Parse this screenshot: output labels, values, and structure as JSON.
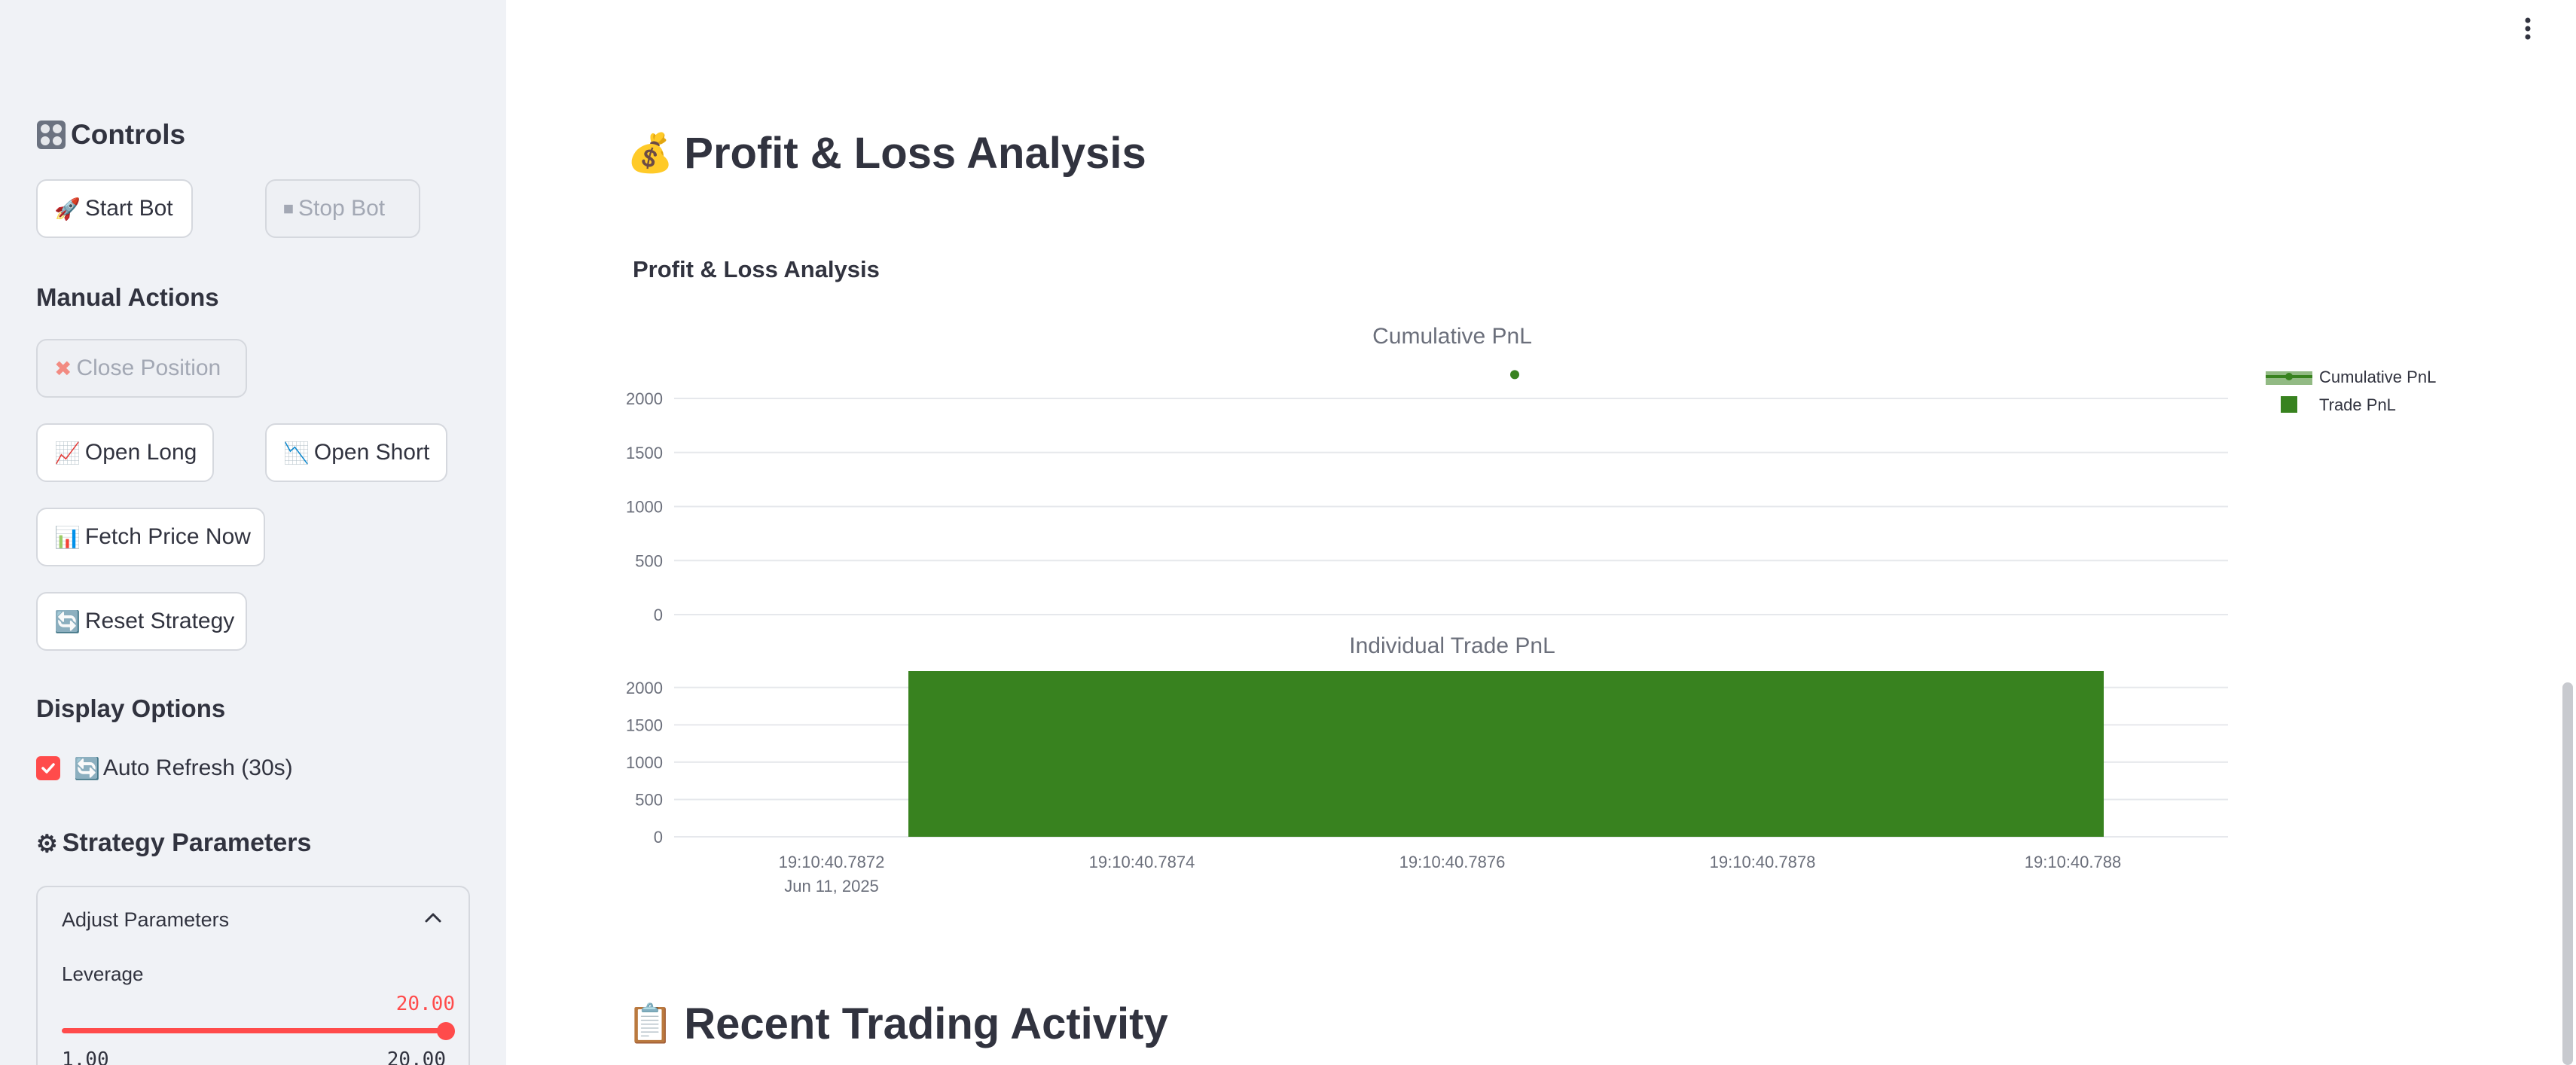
{
  "sidebar": {
    "controls_heading": "Controls",
    "start_bot": "Start Bot",
    "stop_bot": "Stop Bot",
    "manual_actions": "Manual Actions",
    "close_position": "Close Position",
    "open_long": "Open Long",
    "open_short": "Open Short",
    "fetch_price": "Fetch Price Now",
    "reset_strategy": "Reset Strategy",
    "display_options": "Display Options",
    "auto_refresh": "Auto Refresh (30s)",
    "auto_refresh_checked": true,
    "strategy_parameters": "Strategy Parameters",
    "expander_title": "Adjust Parameters",
    "leverage_label": "Leverage",
    "leverage_value": "20.00",
    "leverage_min": "1.00",
    "leverage_max": "20.00",
    "leverage_fraction": 1.0
  },
  "main": {
    "pnl_heading": "Profit & Loss Analysis",
    "chart_heading": "Profit & Loss Analysis",
    "recent_heading": "Recent Trading Activity"
  },
  "colors": {
    "accent": "#ff4b4b",
    "series_green": "#38821f",
    "text": "#31333f",
    "sidebar_bg": "#f0f2f6"
  },
  "chart_data": {
    "type": "bar",
    "subplots": [
      {
        "title": "Cumulative PnL",
        "type": "line",
        "yticks": [
          0,
          500,
          1000,
          1500,
          2000
        ],
        "ylim": [
          0,
          2000
        ],
        "series": [
          {
            "name": "Cumulative PnL",
            "x": [
              "19:10:40.7876"
            ],
            "y": [
              2220
            ]
          }
        ]
      },
      {
        "title": "Individual Trade PnL",
        "type": "bar",
        "yticks": [
          0,
          500,
          1000,
          1500,
          2000
        ],
        "ylim": [
          0,
          2220
        ],
        "series": [
          {
            "name": "Trade PnL",
            "x_start": "19:10:40.7873",
            "x_end": "19:10:40.7881",
            "y": 2220
          }
        ]
      }
    ],
    "x_ticks": [
      "19:10:40.7872",
      "19:10:40.7874",
      "19:10:40.7876",
      "19:10:40.7878",
      "19:10:40.788"
    ],
    "x_date_label": "Jun 11, 2025",
    "legend": [
      "Cumulative PnL",
      "Trade PnL"
    ],
    "legend_position": "top-right",
    "grid": true
  }
}
